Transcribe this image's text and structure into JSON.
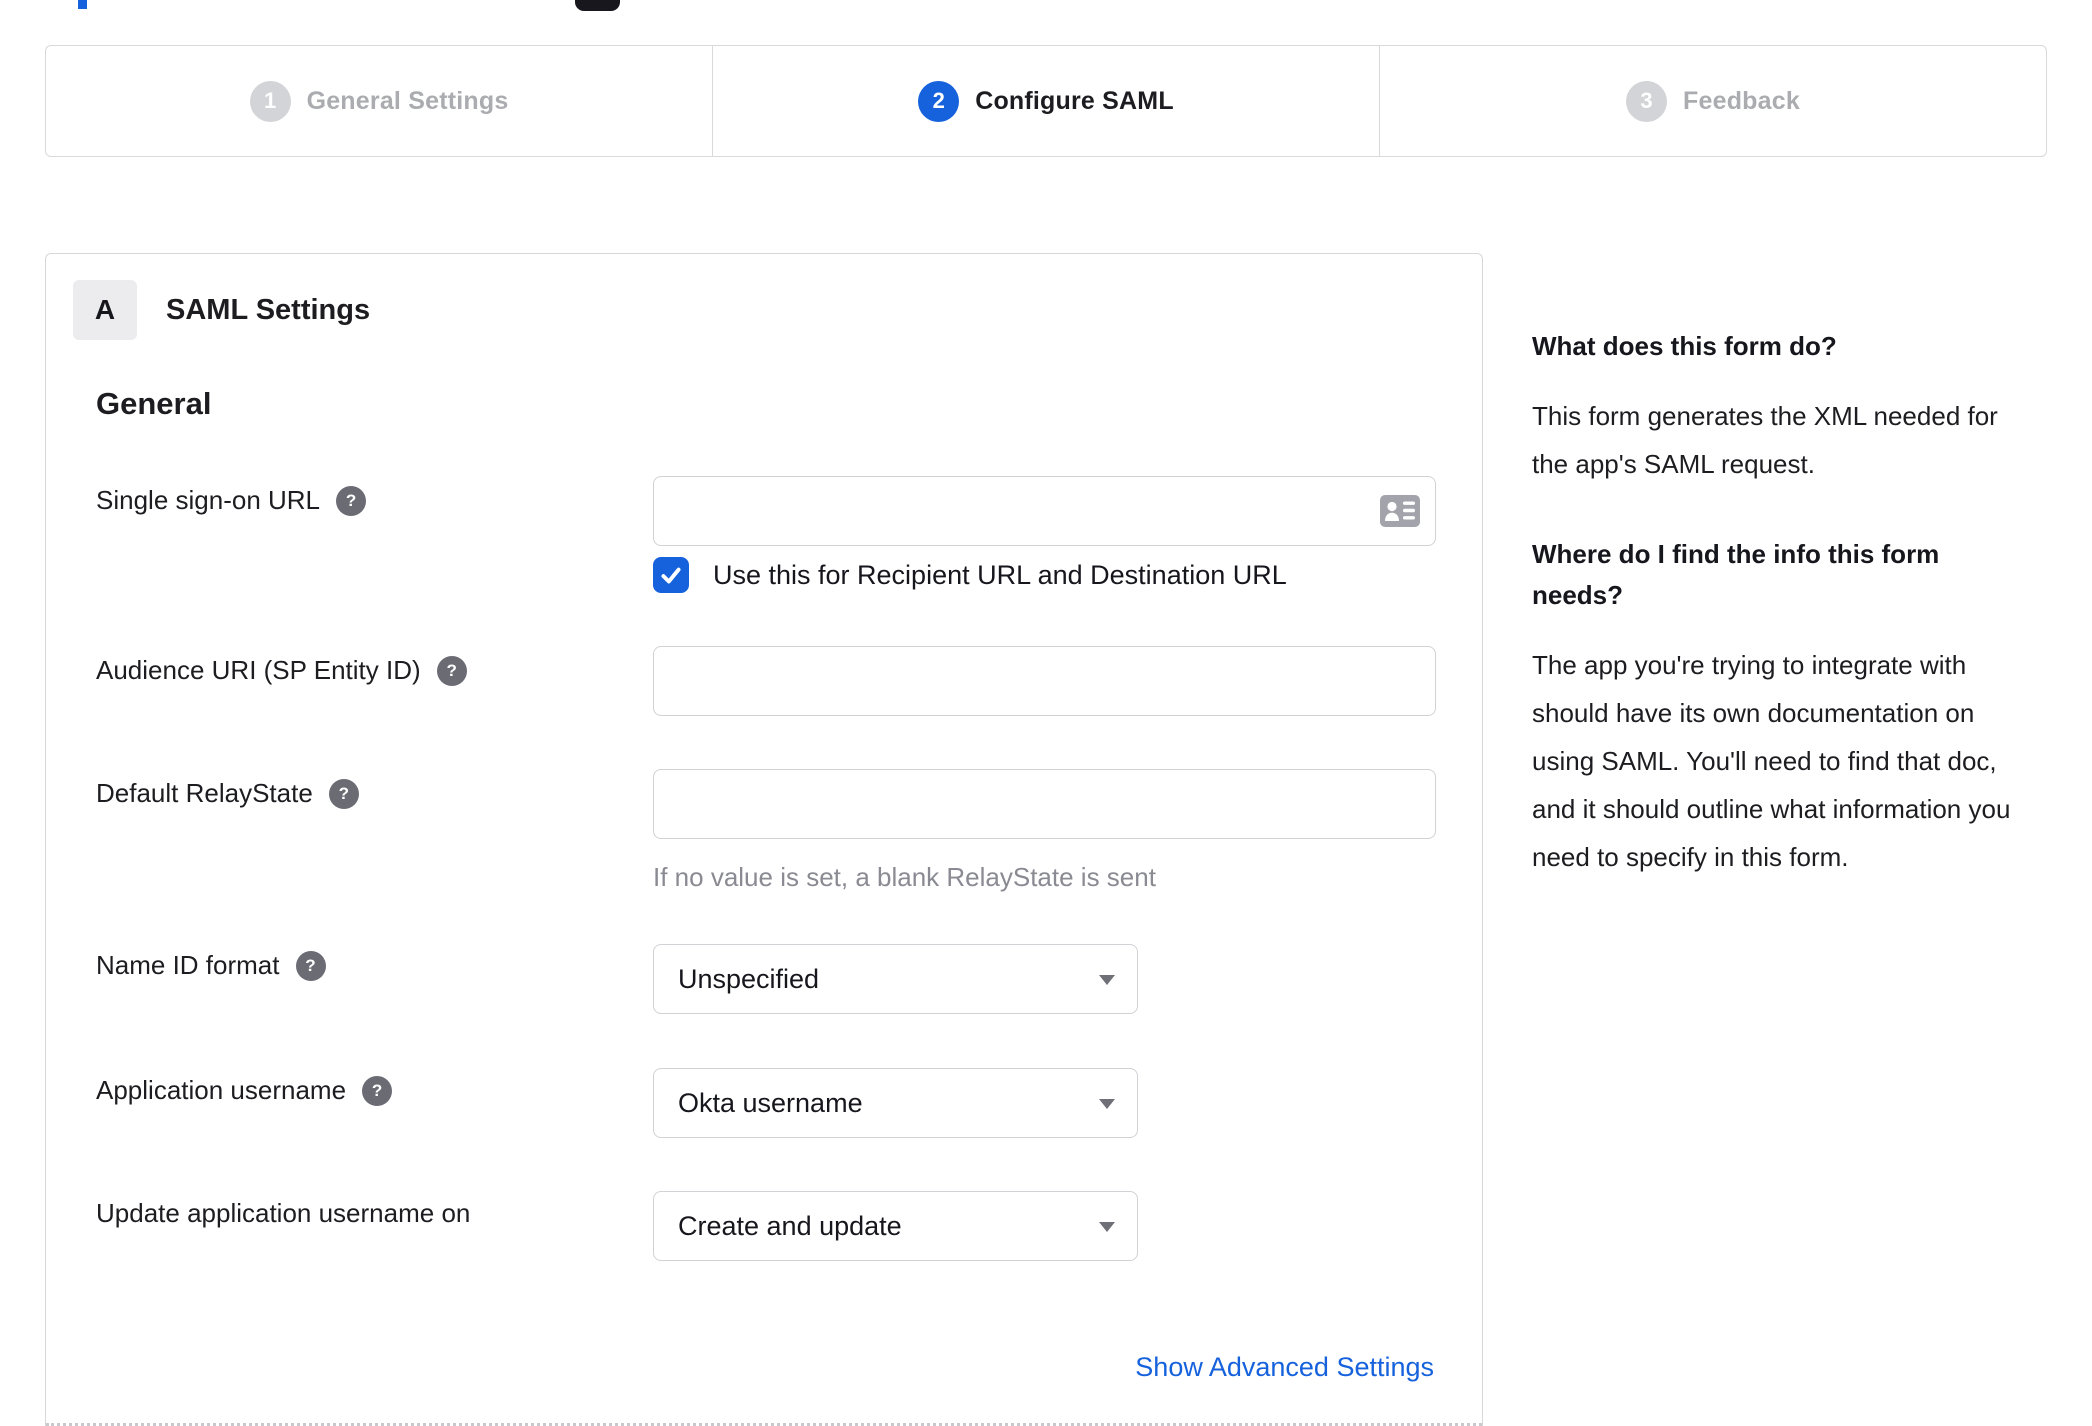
{
  "colors": {
    "accent": "#1662dd",
    "link": "#1662dd",
    "step_inactive_circle": "#d3d4d7",
    "border": "#d8d8da"
  },
  "icons": {
    "help_glyph": "?",
    "help": "question-mark-help-icon",
    "input_right": "contact-card-icon",
    "checkbox": "checkmark-icon",
    "select": "caret-down-icon"
  },
  "stepper": {
    "steps": [
      {
        "number": "1",
        "label": "General Settings",
        "state": "inactive"
      },
      {
        "number": "2",
        "label": "Configure SAML",
        "state": "active"
      },
      {
        "number": "3",
        "label": "Feedback",
        "state": "inactive"
      }
    ]
  },
  "panel": {
    "section_badge": "A",
    "section_title": "SAML Settings",
    "group_heading": "General",
    "fields": {
      "sso": {
        "label": "Single sign-on URL",
        "value": "",
        "checkbox_checked": true,
        "checkbox_label": "Use this for Recipient URL and Destination URL"
      },
      "audience": {
        "label": "Audience URI (SP Entity ID)",
        "value": ""
      },
      "relay_state": {
        "label": "Default RelayState",
        "value": "",
        "helper": "If no value is set, a blank RelayState is sent"
      },
      "name_id_format": {
        "label": "Name ID format",
        "selected": "Unspecified"
      },
      "application_username": {
        "label": "Application username",
        "selected": "Okta username"
      },
      "update_application_username_on": {
        "label": "Update application username on",
        "selected": "Create and update"
      }
    },
    "advanced_link": "Show Advanced Settings"
  },
  "sidebar": {
    "section1_heading": "What does this form do?",
    "section1_body": "This form generates the XML needed for the app's SAML request.",
    "section2_heading": "Where do I find the info this form needs?",
    "section2_body": "The app you're trying to integrate with should have its own documentation on using SAML. You'll need to find that doc, and it should outline what information you need to specify in this form."
  }
}
